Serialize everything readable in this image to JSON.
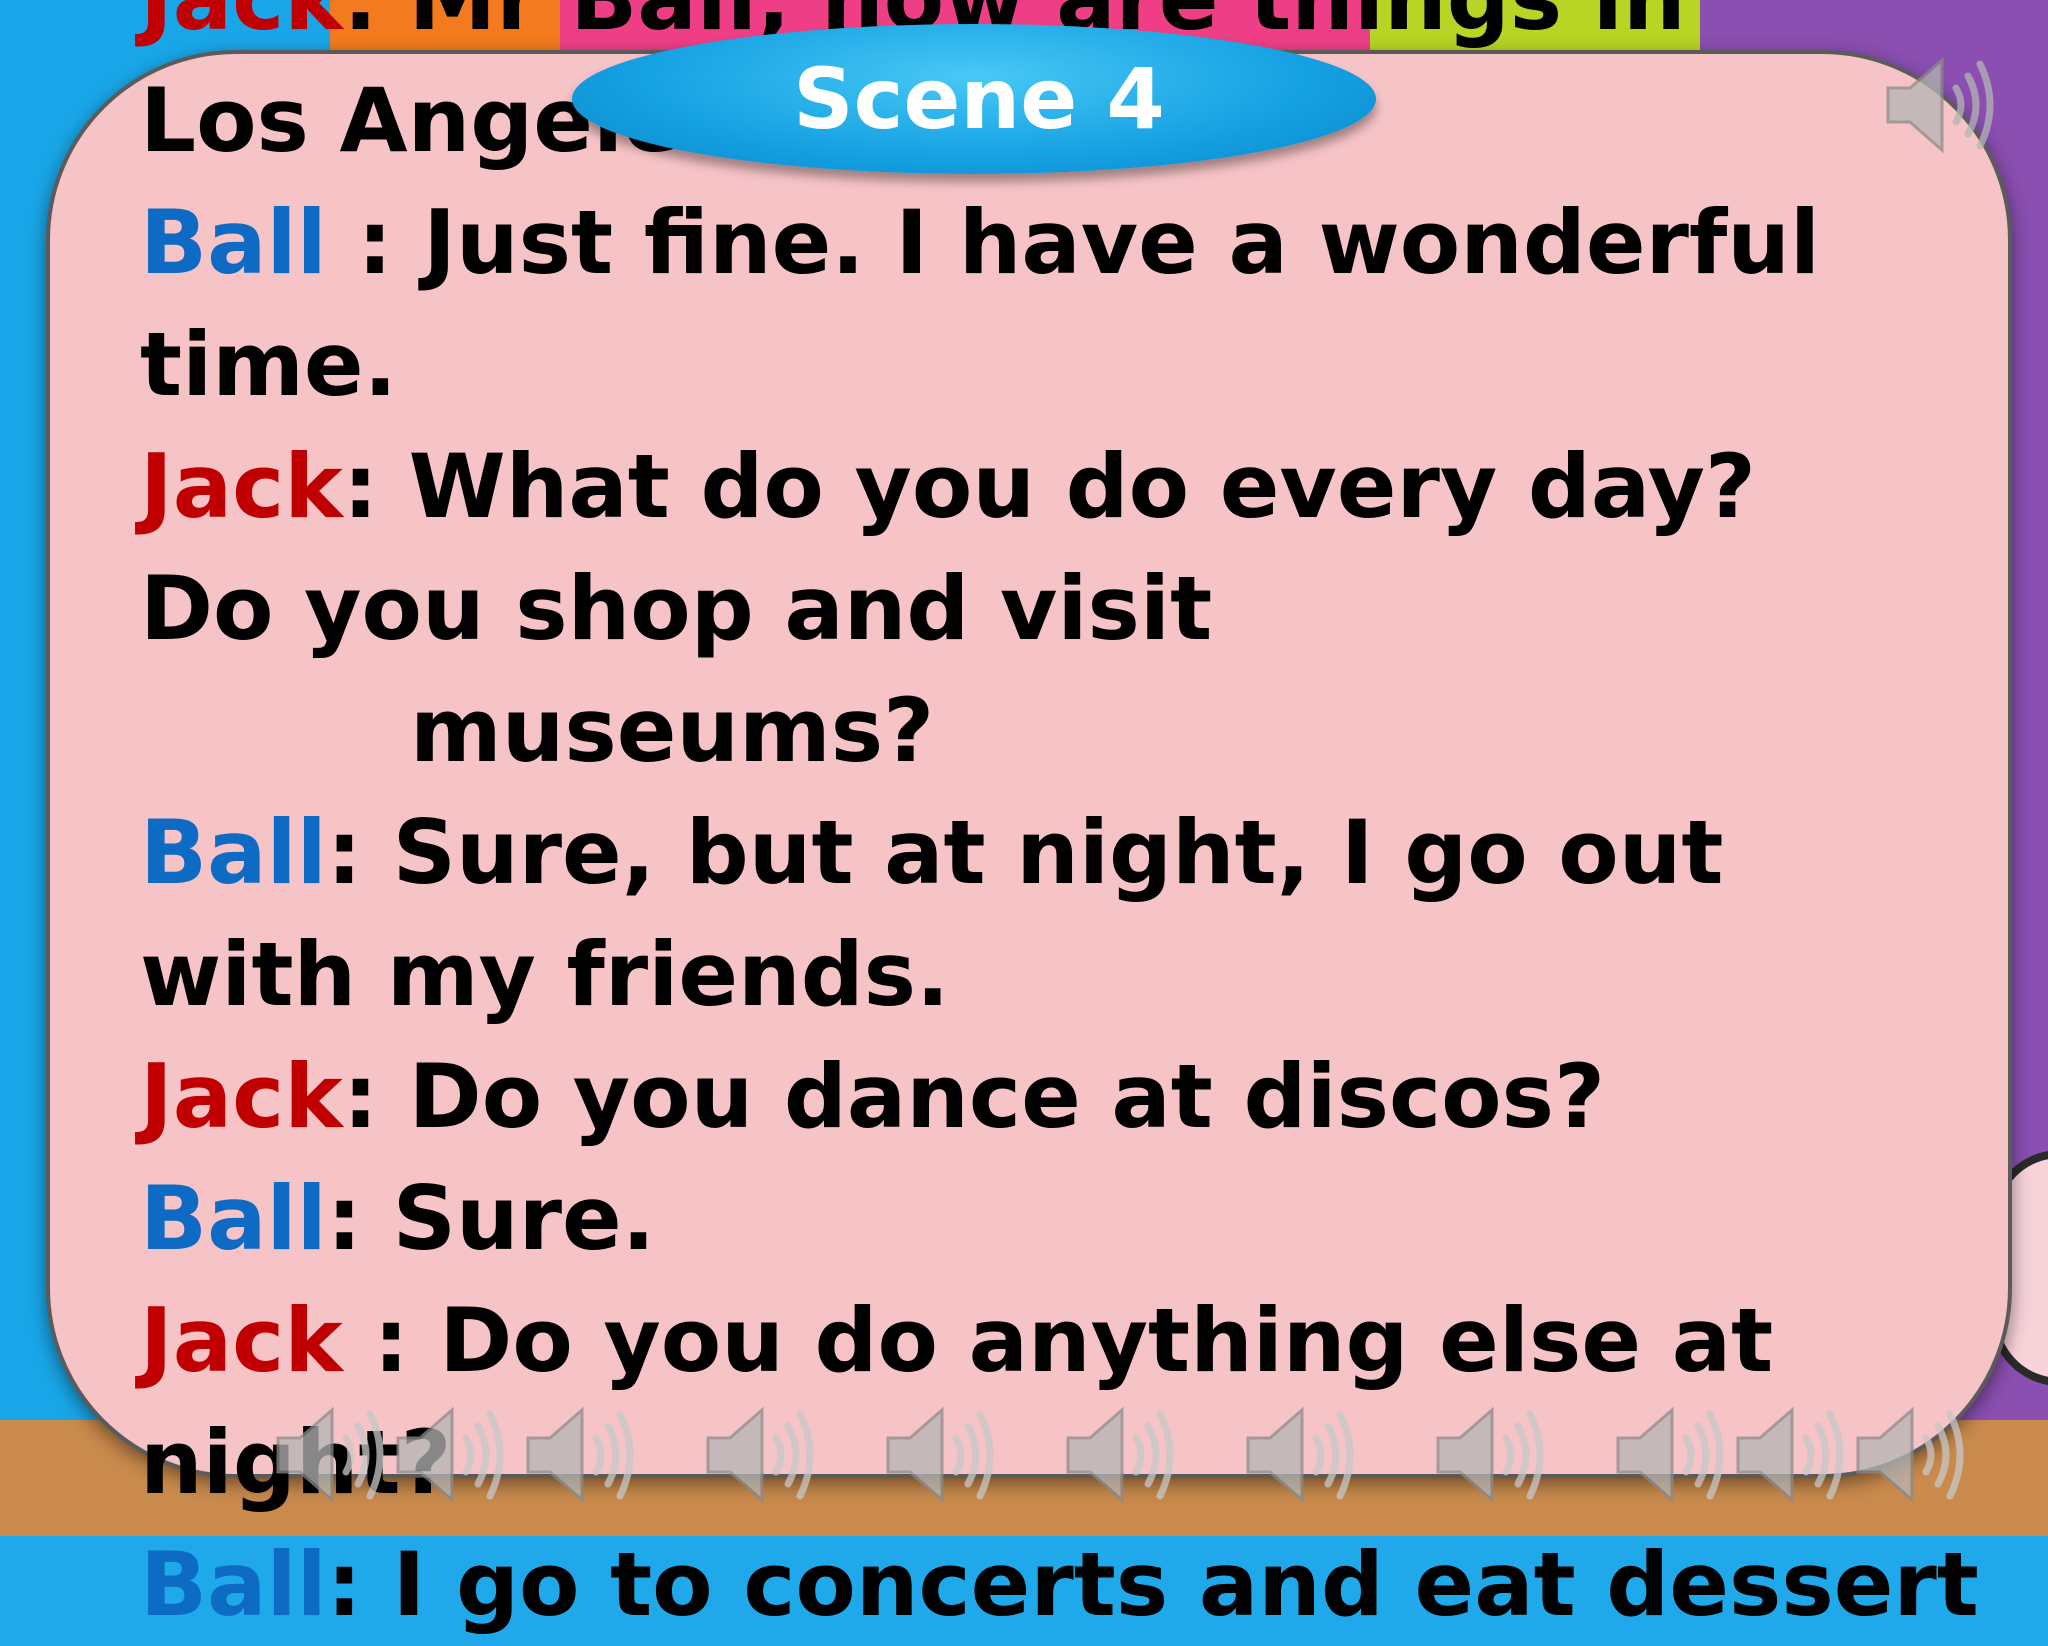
{
  "slide": {
    "scene_title": "Scene 4",
    "lines": [
      {
        "speaker": "Jack",
        "sep": ": ",
        "text": "Mr Ball, how are things in",
        "cls": "jack"
      },
      {
        "speaker": "",
        "sep": "",
        "text": "Los Angeles?",
        "cls": ""
      },
      {
        "speaker": "Ball",
        "sep": " : ",
        "text": "Just fine. I have a wonderful",
        "cls": "ball"
      },
      {
        "speaker": "",
        "sep": "",
        "text": "time.",
        "cls": ""
      },
      {
        "speaker": "Jack",
        "sep": ": ",
        "text": "What do you do every day?",
        "cls": "jack"
      },
      {
        "speaker": "",
        "sep": "",
        "text": "Do you shop and visit",
        "cls": ""
      },
      {
        "speaker": "",
        "sep": "",
        "text": "museums?",
        "cls": "",
        "indent": true
      },
      {
        "speaker": "Ball",
        "sep": ": ",
        "text": "Sure, but at night, I go out",
        "cls": "ball"
      },
      {
        "speaker": "",
        "sep": "",
        "text": "with my friends.",
        "cls": ""
      },
      {
        "speaker": "Jack",
        "sep": ": ",
        "text": "Do you dance at discos?",
        "cls": "jack"
      },
      {
        "speaker": "Ball",
        "sep": ": ",
        "text": "Sure.",
        "cls": "ball"
      },
      {
        "speaker": "Jack",
        "sep": " : ",
        "text": "Do you do anything else at",
        "cls": "jack"
      },
      {
        "speaker": "",
        "sep": "",
        "text": "night?",
        "cls": ""
      },
      {
        "speaker": "Ball",
        "sep": ": ",
        "text": "I go to concerts and eat dessert",
        "cls": "ball"
      }
    ]
  },
  "icons": {
    "top_speaker": "speaker-sound-icon",
    "bottom_speakers": [
      "speaker-sound-icon",
      "speaker-sound-icon",
      "speaker-sound-icon",
      "speaker-sound-icon",
      "speaker-sound-icon",
      "speaker-sound-icon",
      "speaker-sound-icon",
      "speaker-sound-icon",
      "speaker-sound-icon",
      "speaker-sound-icon",
      "speaker-sound-icon"
    ]
  },
  "colors": {
    "ball": "#0e6bc3",
    "jack": "#c00000",
    "card": "#f6c3c6",
    "scene_oval": "#14a0e2"
  }
}
